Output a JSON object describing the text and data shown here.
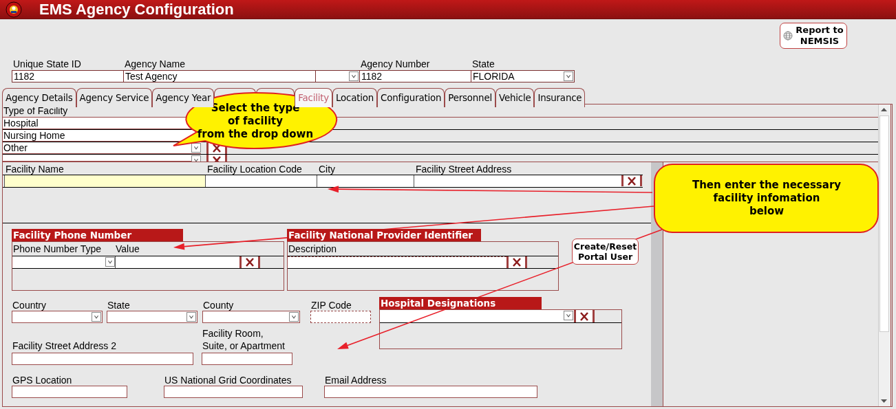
{
  "app": {
    "title": "EMS Agency Configuration"
  },
  "report_button": {
    "label": "Report to NEMSIS"
  },
  "agency_fields": [
    {
      "label": "Unique State ID",
      "value": "1182",
      "kind": "text"
    },
    {
      "label": "Agency Name",
      "value": "Test Agency",
      "kind": "text"
    },
    {
      "kind": "select"
    },
    {
      "label": "Agency Number",
      "value": "1182",
      "kind": "text"
    },
    {
      "label": "State",
      "value": "FLORIDA",
      "kind": "select"
    }
  ],
  "tabs": [
    {
      "label": "Agency Details",
      "selected": false
    },
    {
      "label": "Agency Service",
      "selected": false
    },
    {
      "label": "Agency Year",
      "selected": false
    },
    {
      "selected": false
    },
    {
      "selected": false
    },
    {
      "label": "Facility",
      "selected": true
    },
    {
      "label": "Location",
      "selected": false
    },
    {
      "label": "Configuration",
      "selected": false
    },
    {
      "label": "Personnel",
      "selected": false
    },
    {
      "label": "Vehicle",
      "selected": false
    },
    {
      "label": "Insurance",
      "selected": false
    }
  ],
  "facility_types": {
    "header": "Type of Facility",
    "rows": [
      {
        "value": "Hospital",
        "kind": "text"
      },
      {
        "value": "Nursing Home",
        "kind": "text"
      },
      {
        "value": "Other",
        "kind": "select"
      },
      {
        "kind": "select"
      }
    ]
  },
  "facilities": {
    "columns": [
      "Facility Name",
      "Facility Location Code",
      "City",
      "Facility Street Address"
    ],
    "rows": [
      {
        "focused": true
      }
    ]
  },
  "phone_numbers": {
    "title": "Facility Phone Number",
    "columns": [
      "Phone Number Type",
      "Value"
    ]
  },
  "npi": {
    "title": "Facility National Provider Identifier",
    "columns": [
      "Description"
    ]
  },
  "portal_button": {
    "label": "Create/Reset Portal User"
  },
  "address_fields": [
    {
      "label": "Country",
      "kind": "select"
    },
    {
      "label": "State",
      "kind": "select"
    },
    {
      "label": "County",
      "kind": "select"
    },
    {
      "label": "ZIP Code",
      "kind": "masked"
    }
  ],
  "hospital_designations": {
    "title": "Hospital Designations"
  },
  "room_fields": [
    {
      "label": "Facility Street Address 2"
    },
    {
      "label": "Facility Room, Suite, or Apartment"
    }
  ],
  "contact_fields": [
    {
      "label": "GPS Location"
    },
    {
      "label": "US National Grid Coordinates"
    },
    {
      "label": "Email Address"
    }
  ],
  "callouts": [
    {
      "text": "Select the type\nof facility\nfrom the drop down",
      "kind": "oval"
    },
    {
      "text": "Then enter the necessary\nfacility infomation\nbelow",
      "kind": "box"
    }
  ]
}
